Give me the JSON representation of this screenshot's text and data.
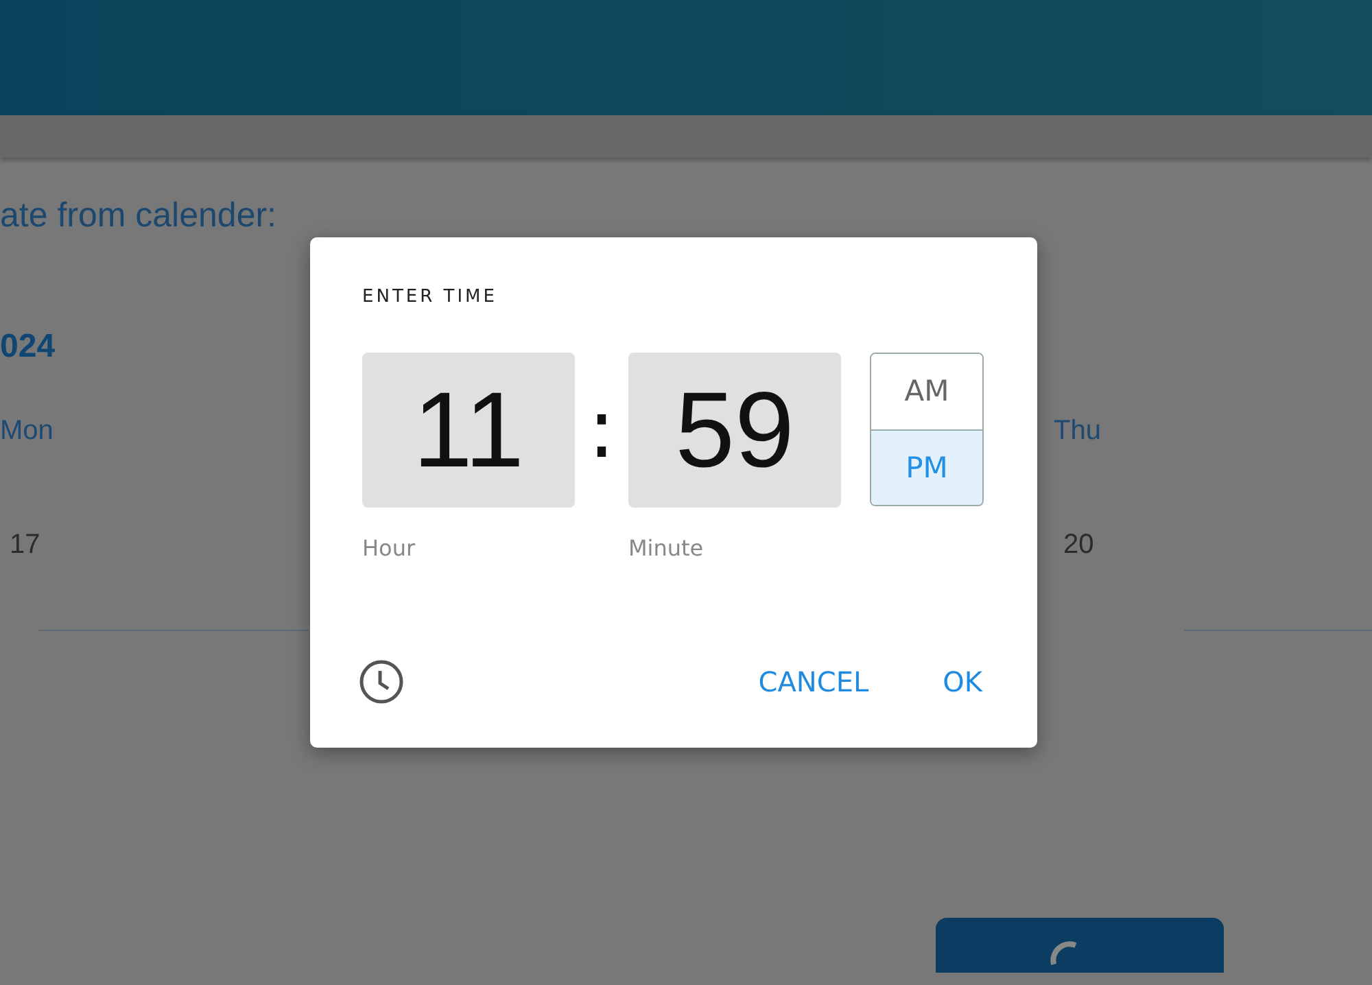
{
  "page": {
    "heading": "ate from calender:",
    "year": "024",
    "columns": [
      {
        "day": "Mon",
        "date": "17"
      },
      {
        "day": "Thu",
        "date": "20"
      }
    ]
  },
  "dialog": {
    "title": "ENTER TIME",
    "hour": {
      "value": "11",
      "label": "Hour"
    },
    "separator": ":",
    "minute": {
      "value": "59",
      "label": "Minute"
    },
    "periods": [
      {
        "label": "AM",
        "selected": false
      },
      {
        "label": "PM",
        "selected": true
      }
    ],
    "buttons": [
      "CANCEL",
      "OK"
    ]
  }
}
